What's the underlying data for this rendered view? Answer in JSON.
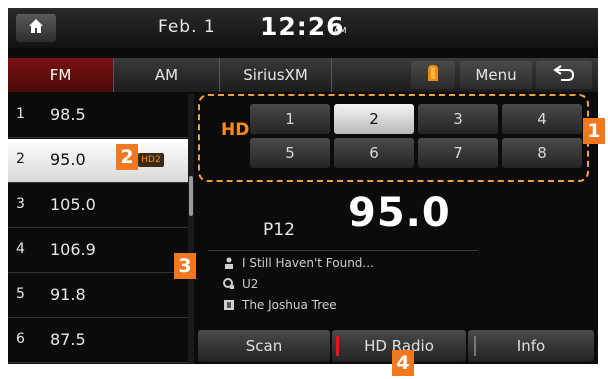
{
  "status": {
    "date": "Feb.  1",
    "time": "12:26",
    "ampm": "AM"
  },
  "tabs": [
    {
      "label": "FM",
      "active": true
    },
    {
      "label": "AM",
      "active": false
    },
    {
      "label": "SiriusXM",
      "active": false
    }
  ],
  "header": {
    "menu_label": "Menu"
  },
  "stations": [
    {
      "num": "1",
      "freq": "98.5"
    },
    {
      "num": "2",
      "freq": "95.0",
      "selected": true,
      "hd_badge": "HD2"
    },
    {
      "num": "3",
      "freq": "105.0"
    },
    {
      "num": "4",
      "freq": "106.9"
    },
    {
      "num": "5",
      "freq": "91.8"
    },
    {
      "num": "6",
      "freq": "87.5"
    }
  ],
  "hd": {
    "logo": "HD",
    "channels": [
      "1",
      "2",
      "3",
      "4",
      "5",
      "6",
      "7",
      "8"
    ],
    "selected_channel": "2"
  },
  "now_playing": {
    "preset": "P12",
    "frequency": "95.0",
    "song": "I Still Haven't Found...",
    "artist": "U2",
    "album": "The Joshua Tree"
  },
  "bottom_buttons": {
    "scan": "Scan",
    "hd_radio": "HD Radio",
    "info": "Info"
  },
  "callouts": [
    "1",
    "2",
    "3",
    "4"
  ],
  "colors": {
    "accent": "#f07820",
    "tab_active": "#6e1010",
    "hd_orange": "#ff8a1a",
    "indicator_red": "#e01a1a"
  }
}
